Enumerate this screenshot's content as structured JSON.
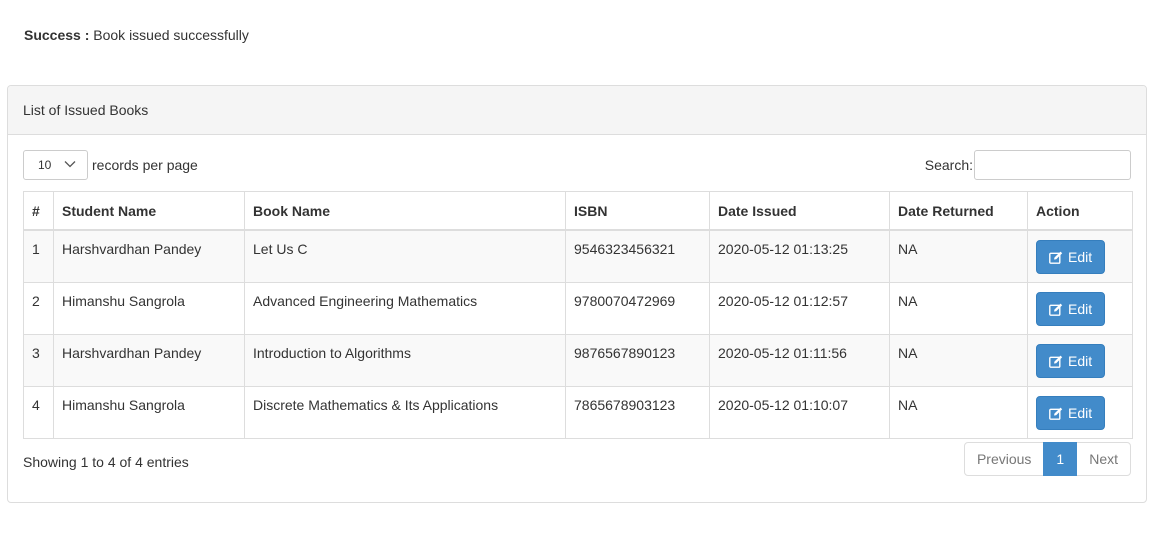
{
  "alert": {
    "label": "Success :",
    "message": "Book issued successfully"
  },
  "panel": {
    "heading": "List of Issued Books",
    "length_value": "10",
    "length_label": "records per page",
    "search_label": "Search:",
    "search_value": ""
  },
  "table": {
    "headers": [
      "#",
      "Student Name",
      "Book Name",
      "ISBN",
      "Date Issued",
      "Date Returned",
      "Action"
    ],
    "rows": [
      {
        "num": "1",
        "student": "Harshvardhan Pandey",
        "book": "Let Us C",
        "isbn": "9546323456321",
        "issued": "2020-05-12 01:13:25",
        "returned": "NA",
        "action": "Edit"
      },
      {
        "num": "2",
        "student": "Himanshu Sangrola",
        "book": "Advanced Engineering Mathematics",
        "isbn": "9780070472969",
        "issued": "2020-05-12 01:12:57",
        "returned": "NA",
        "action": "Edit"
      },
      {
        "num": "3",
        "student": "Harshvardhan Pandey",
        "book": "Introduction to Algorithms",
        "isbn": "9876567890123",
        "issued": "2020-05-12 01:11:56",
        "returned": "NA",
        "action": "Edit"
      },
      {
        "num": "4",
        "student": "Himanshu Sangrola",
        "book": "Discrete Mathematics & Its Applications",
        "isbn": "7865678903123",
        "issued": "2020-05-12 01:10:07",
        "returned": "NA",
        "action": "Edit"
      }
    ]
  },
  "footer": {
    "info": "Showing 1 to 4 of 4 entries",
    "pagination": {
      "previous": "Previous",
      "current": "1",
      "next": "Next"
    }
  },
  "icons": {
    "edit": "edit-icon",
    "dropdown": "chevron-down-icon"
  },
  "colors": {
    "primary": "#428bca",
    "stripe": "#f9f9f9",
    "border": "#dddddd"
  }
}
